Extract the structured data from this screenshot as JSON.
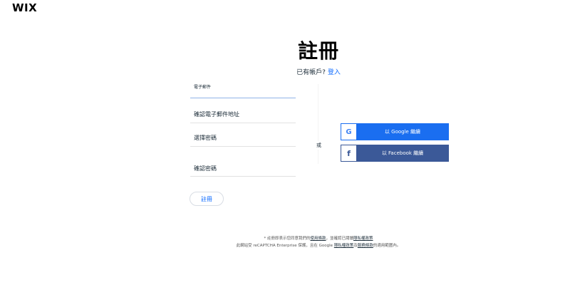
{
  "logo": "WIX",
  "header": {
    "title": "註冊",
    "subtitle_text": "已有帳戶?",
    "login_link": "登入"
  },
  "form": {
    "email_label": "電子郵件",
    "confirm_email_label": "確認電子郵件地址",
    "password_label": "選擇密碼",
    "confirm_password_label": "確認密碼",
    "submit_label": "註冊"
  },
  "divider": {
    "or_text": "或"
  },
  "social": {
    "google_label": "以 Google 繼續",
    "google_icon": "G",
    "facebook_label": "以 Facebook 繼續",
    "facebook_icon": "f"
  },
  "footer": {
    "line1_prefix": "* 註冊即表示您同意我們的",
    "terms_link": "使用條款",
    "line1_middle": "，並確認已閱讀",
    "privacy_link": "隱私權政策",
    "line2_prefix": "此網站受 reCAPTCHA Enterprise 保護，且在 Google ",
    "google_privacy_link": "隱私權政策",
    "line2_and": "及",
    "google_terms_link": "服務條款",
    "line2_suffix": "的適用範圍內。"
  },
  "colors": {
    "brand_blue": "#116dff",
    "google_blue": "#1a6ef0",
    "facebook_blue": "#3b5998",
    "text_dark": "#20303c"
  }
}
